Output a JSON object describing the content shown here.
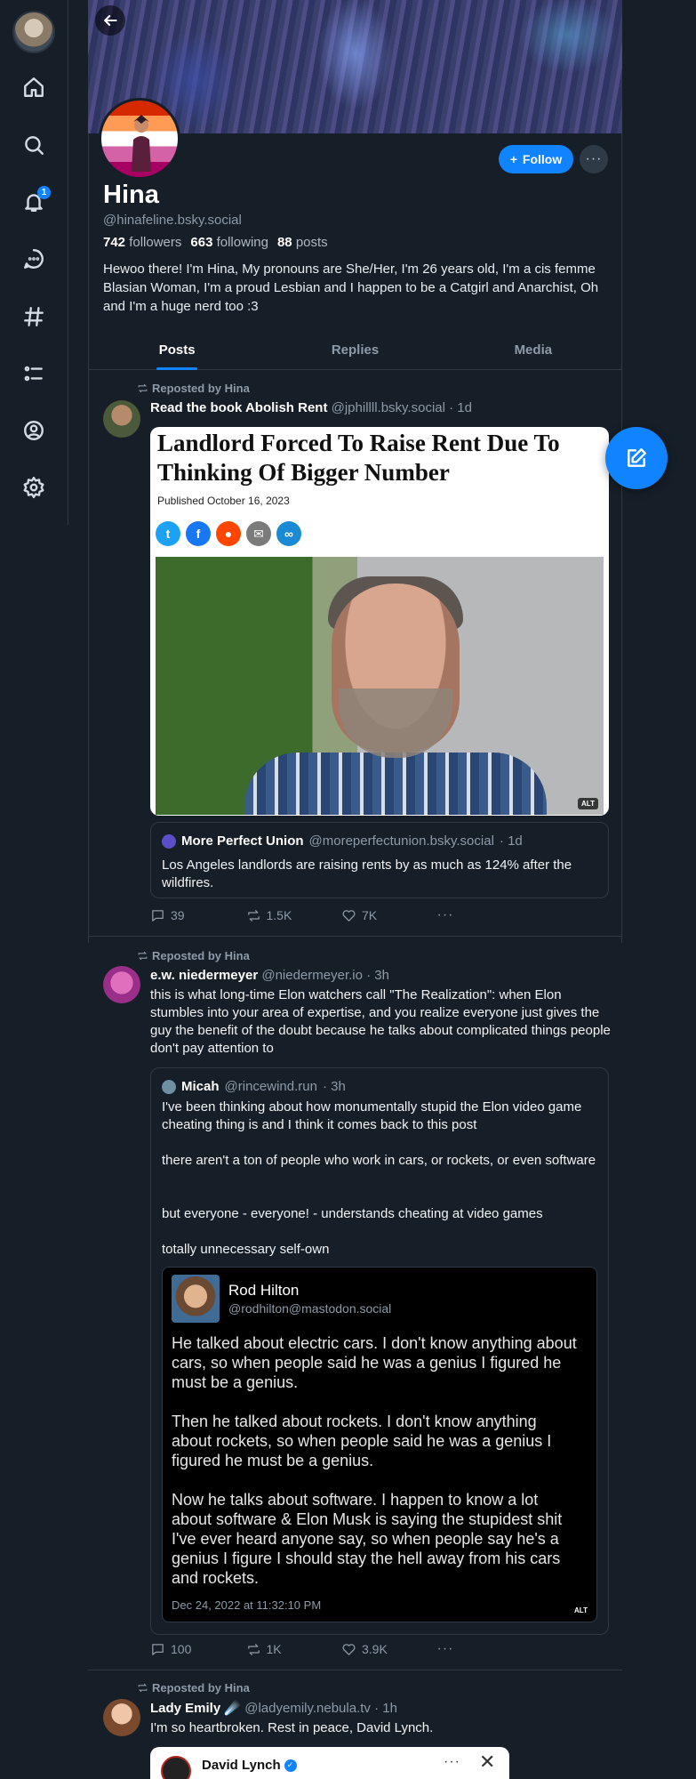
{
  "nav": {
    "items": [
      "home-icon",
      "search-icon",
      "bell-icon",
      "chat-icon",
      "hashtag-icon",
      "list-icon",
      "profile-icon",
      "gear-icon"
    ],
    "notification_count": "1"
  },
  "profile": {
    "display_name": "Hina",
    "handle": "@hinafeline.bsky.social",
    "followers_count": "742",
    "followers_label": "followers",
    "following_count": "663",
    "following_label": "following",
    "posts_count": "88",
    "posts_label": "posts",
    "bio": "Hewoo there! I'm Hina, My pronouns are She/Her, I'm 26 years old, I'm a cis femme Blasian Woman, I'm a proud Lesbian and I happen to be a Catgirl and Anarchist, Oh and I'm a huge nerd too :3",
    "follow_label": "Follow",
    "more_label": "···"
  },
  "tabs": [
    {
      "label": "Posts",
      "active": true
    },
    {
      "label": "Replies",
      "active": false
    },
    {
      "label": "Media",
      "active": false
    }
  ],
  "posts": [
    {
      "repost_by": "Reposted by Hina",
      "author_name": "Read the book Abolish Rent",
      "author_handle": "@jphillll.bsky.social",
      "time": "· 1d",
      "article": {
        "headline": "Landlord Forced To Raise Rent Due To Thinking Of Bigger Number",
        "pubdate": "Published October 16, 2023",
        "alt": "ALT"
      },
      "quote": {
        "name": "More Perfect Union",
        "handle": "@moreperfectunion.bsky.social",
        "time": "· 1d",
        "text": "Los Angeles landlords are raising rents by as much as 124% after the wildfires."
      },
      "replies": "39",
      "reposts": "1.5K",
      "likes": "7K"
    },
    {
      "repost_by": "Reposted by Hina",
      "author_name": "e.w. niedermeyer",
      "author_handle": "@niedermeyer.io",
      "time": "· 3h",
      "text": "this is what long-time Elon watchers call \"The Realization\": when Elon stumbles into your area of expertise, and you realize everyone just gives the guy the benefit of the doubt because he talks about complicated things people don't pay attention to",
      "quote": {
        "name": "Micah",
        "handle": "@rincewind.run",
        "time": "· 3h",
        "p1": "I've been thinking about how monumentally stupid the Elon video game cheating thing is and I think it comes back to this post",
        "p2": "there aren't a ton of people who work in cars, or rockets, or even software",
        "p3": "but everyone - everyone! - understands cheating at video games",
        "p4": "totally unnecessary self-own",
        "tweet": {
          "name": "Rod Hilton",
          "handle": "@rodhilton@mastodon.social",
          "body": "He talked about electric cars. I don't know anything about cars, so when people said he was a genius I figured he must be a genius.\n\nThen he talked about rockets. I don't know anything about rockets, so when people said he was a genius I figured he must be a genius.\n\nNow he talks about software. I happen to know a lot about software & Elon Musk is saying the stupidest shit I've ever heard anyone say, so when people say he's a genius I figure I should stay the hell away from his cars and rockets.",
          "date": "Dec 24, 2022 at 11:32:10 PM",
          "alt": "ALT"
        }
      },
      "replies": "100",
      "reposts": "1K",
      "likes": "3.9K"
    },
    {
      "repost_by": "Reposted by Hina",
      "author_name": "Lady Emily",
      "author_emoji": "☄️",
      "author_handle": "@ladyemily.nebula.tv",
      "time": "· 1h",
      "text": "I'm so heartbroken. Rest in peace, David Lynch.",
      "embed": {
        "name": "David Lynch",
        "dots": "···",
        "close": "✕"
      }
    }
  ],
  "colors": {
    "accent": "#1083fe",
    "background": "#161e27",
    "border": "#2e3a46",
    "muted": "#8d9aa8"
  }
}
